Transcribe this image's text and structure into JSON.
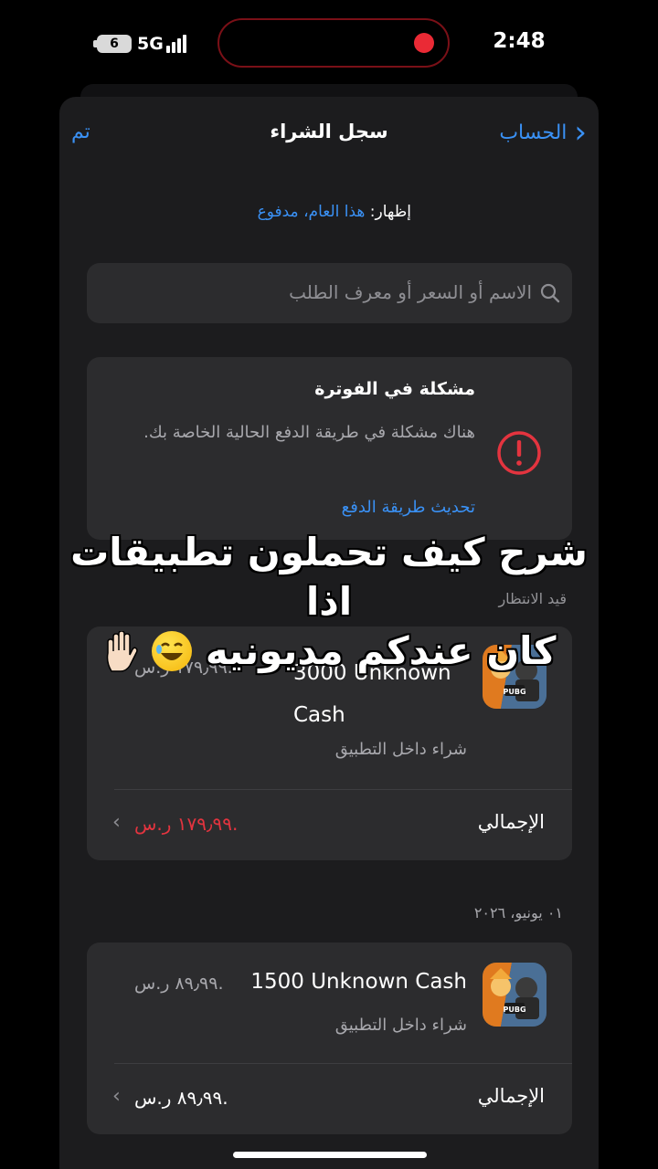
{
  "status_bar": {
    "battery": "6",
    "network": "5G",
    "time": "2:48",
    "recording_color": "#ea2a35"
  },
  "nav": {
    "done_label": "تم",
    "title": "سجل الشراء",
    "back_label": "الحساب",
    "accent": "#3a91f5"
  },
  "filter": {
    "label": "إظهار: ",
    "value": "هذا العام، مدفوع"
  },
  "search": {
    "placeholder": "الاسم أو السعر أو معرف الطلب",
    "icon": "search-icon"
  },
  "billing_alert": {
    "title": "مشكلة في الفوترة",
    "body": "هناك مشكلة في طريقة الدفع الحالية الخاصة بك.",
    "link": "تحديث طريقة الدفع",
    "icon": "exclamation-circle-icon",
    "icon_color": "#e3343f"
  },
  "overlay_caption": {
    "line1": "شرح كيف تحملون تطبيقات اذا",
    "line2": "كان عندكم مديونيه"
  },
  "pending_label": "قيد الانتظار",
  "purchases": [
    {
      "title": "3000 Unknown Cash",
      "type": "شراء داخل التطبيق",
      "price": "١٧٩٫٩٩ ر.س.",
      "total_label": "الإجمالي",
      "total": "١٧٩٫٩٩ ر.س.",
      "total_color": "#e3343f",
      "icon": "pubg-mobile-app-icon"
    },
    {
      "date": "٠١ يونيو، ٢٠٢٦",
      "title": "1500 Unknown Cash",
      "type": "شراء داخل التطبيق",
      "price": "٨٩٫٩٩ ر.س.",
      "total_label": "الإجمالي",
      "total": "٨٩٫٩٩ ر.س.",
      "total_color": "#ffffff",
      "icon": "pubg-mobile-app-icon"
    }
  ]
}
